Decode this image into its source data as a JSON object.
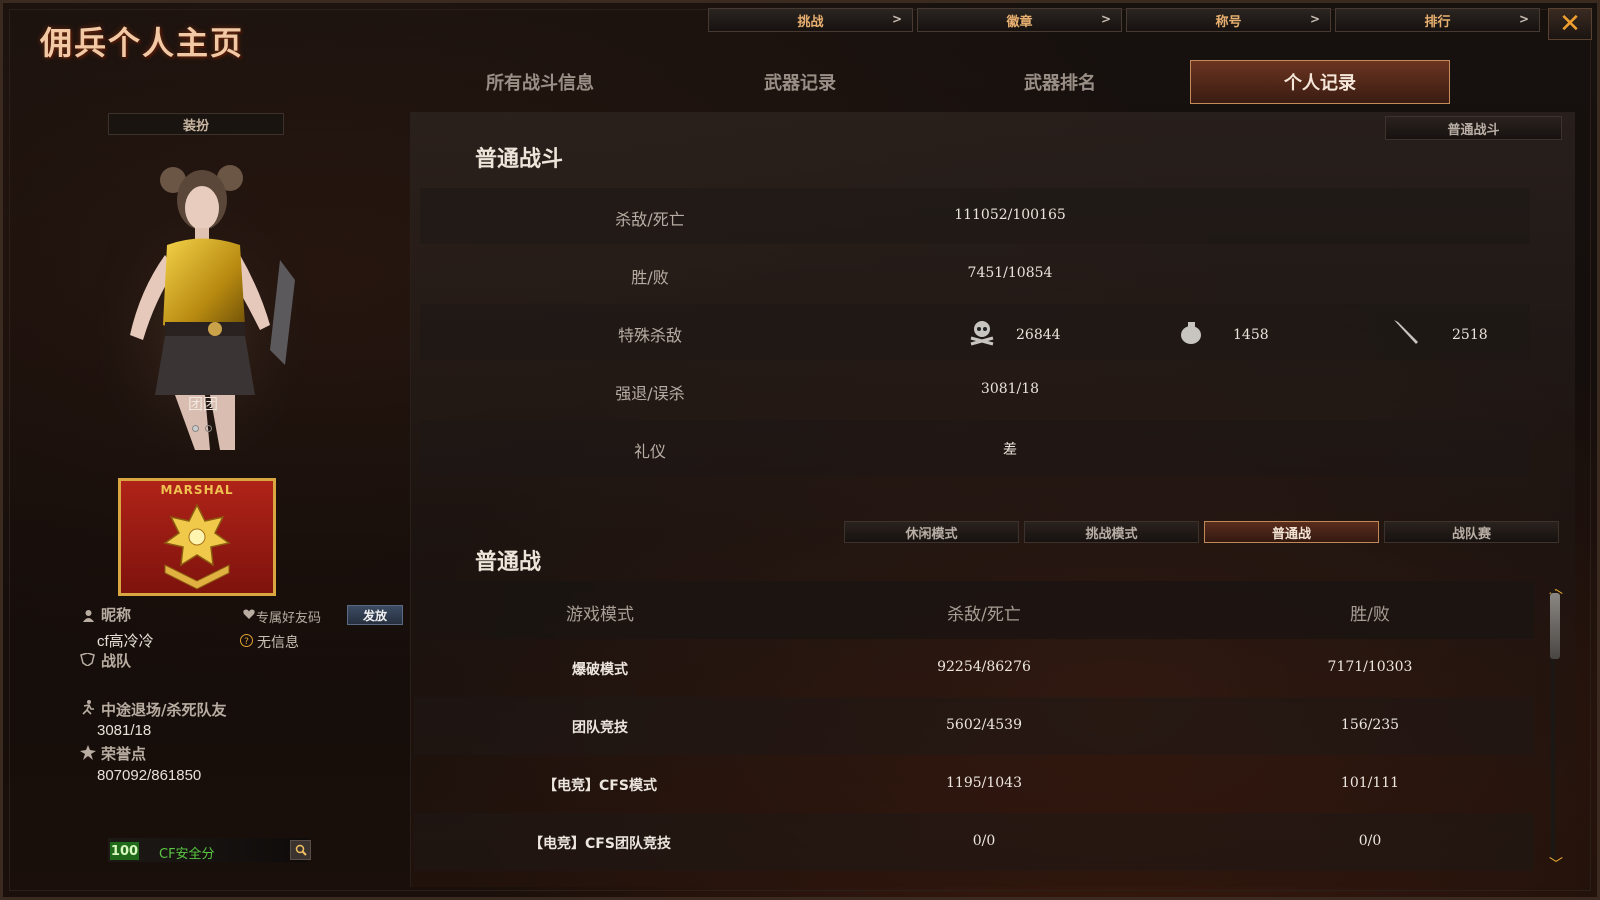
{
  "app": {
    "title": "佣兵个人主页"
  },
  "topnav": [
    {
      "label": "挑战",
      "chevron": ">"
    },
    {
      "label": "徽章",
      "chevron": ">"
    },
    {
      "label": "称号",
      "chevron": ">"
    },
    {
      "label": "排行",
      "chevron": ">"
    }
  ],
  "close_label": "✕",
  "tabs": [
    {
      "label": "所有战斗信息",
      "active": false
    },
    {
      "label": "武器记录",
      "active": false
    },
    {
      "label": "武器排名",
      "active": false
    },
    {
      "label": "个人记录",
      "active": true
    }
  ],
  "left": {
    "dress_label": "装扮",
    "character_name": "团团",
    "rank_badge_text": "MARSHAL",
    "nickname_label": "昵称",
    "nickname_value": "cf高冷冷",
    "friend_code_label": "专属好友码",
    "add_button_label": "发放",
    "friend_code_value": "无信息",
    "team_label": "战队",
    "quit_kill_label": "中途退场/杀死队友",
    "quit_kill_value": "3081/18",
    "honor_label": "荣誉点",
    "honor_value": "807092/861850",
    "security_score": "100",
    "security_label": "CF安全分"
  },
  "normal_battle": {
    "title": "普通战斗",
    "mode_select": "普通战斗",
    "rows": [
      {
        "label": "杀敌/死亡",
        "value": "111052/100165"
      },
      {
        "label": "胜/败",
        "value": "7451/10854"
      },
      {
        "label": "特殊杀敌",
        "value": ""
      },
      {
        "label": "强退/误杀",
        "value": "3081/18"
      },
      {
        "label": "礼仪",
        "value": "差"
      }
    ],
    "special_kills": [
      {
        "icon": "skull-icon",
        "value": "26844"
      },
      {
        "icon": "grenade-icon",
        "value": "1458"
      },
      {
        "icon": "knife-icon",
        "value": "2518"
      }
    ]
  },
  "mode_table": {
    "title": "普通战",
    "filters": [
      {
        "label": "休闲模式",
        "active": false
      },
      {
        "label": "挑战模式",
        "active": false
      },
      {
        "label": "普通战",
        "active": true
      },
      {
        "label": "战队赛",
        "active": false
      }
    ],
    "headers": [
      "游戏模式",
      "杀敌/死亡",
      "胜/败"
    ],
    "rows": [
      [
        "爆破模式",
        "92254/86276",
        "7171/10303"
      ],
      [
        "团队竞技",
        "5602/4539",
        "156/235"
      ],
      [
        "【电竞】CFS模式",
        "1195/1043",
        "101/111"
      ],
      [
        "【电竞】CFS团队竞技",
        "0/0",
        "0/0"
      ]
    ]
  },
  "colors": {
    "accent": "#c48a5a",
    "active_tab": "#6b3420",
    "security_green": "#59c742"
  }
}
